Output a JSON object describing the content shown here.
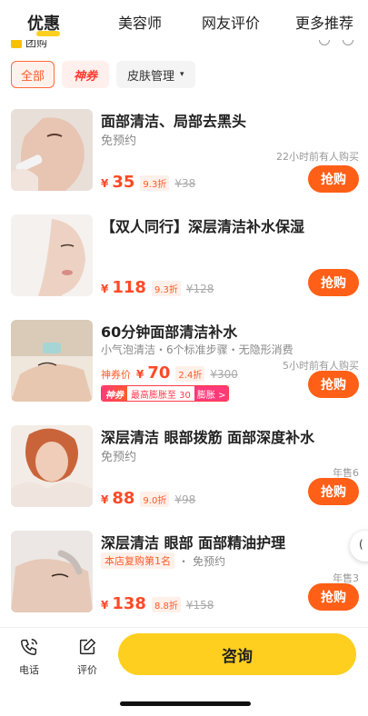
{
  "top_tabs": [
    {
      "label": "优惠",
      "active": true
    },
    {
      "label": "美容师",
      "active": false
    },
    {
      "label": "网友评价",
      "active": false
    },
    {
      "label": "更多推荐",
      "active": false
    }
  ],
  "group_label": "团购",
  "filters": {
    "all": "全部",
    "shenquan": "神券",
    "category": "皮肤管理"
  },
  "items": [
    {
      "title": "面部清洁、局部去黑头",
      "subtitle": "免预约",
      "meta": "22小时前有人购买",
      "price_symbol": "¥",
      "price": "35",
      "discount": "9.3折",
      "original": "¥38",
      "buy": "抢购"
    },
    {
      "title": "【双人同行】深层清洁补水保湿",
      "price_symbol": "¥",
      "price": "118",
      "discount": "9.3折",
      "original": "¥128",
      "buy": "抢购"
    },
    {
      "title": "60分钟面部清洁补水",
      "subtitle": "小气泡清洁・6个标准步骤・无隐形消费",
      "meta": "5小时前有人购买",
      "price_prefix": "神券价",
      "price_symbol": "¥",
      "price": "70",
      "discount": "2.4折",
      "original": "¥300",
      "promo_left": "神券",
      "promo_mid": "最高膨胀至 30",
      "promo_right": "膨胀 >",
      "buy": "抢购"
    },
    {
      "title": "深层清洁 眼部拨筋 面部深度补水",
      "subtitle": "免预约",
      "meta": "年售6",
      "price_symbol": "¥",
      "price": "88",
      "discount": "9.0折",
      "original": "¥98",
      "buy": "抢购"
    },
    {
      "title": "深层清洁 眼部 面部精油护理",
      "rank_tag": "本店复购第1名",
      "subtitle": "免预约",
      "meta": "年售3",
      "price_symbol": "¥",
      "price": "138",
      "discount": "8.8折",
      "original": "¥158",
      "buy": "抢购"
    }
  ],
  "bottom_bar": {
    "phone": "电话",
    "review": "评价",
    "consult": "咨询"
  },
  "icons": {
    "phone": "phone-icon",
    "review": "edit-square-icon"
  },
  "colors": {
    "accent_yellow": "#ffcf1f",
    "price_orange": "#ff4a26",
    "buy_button": "#ff5f16"
  }
}
